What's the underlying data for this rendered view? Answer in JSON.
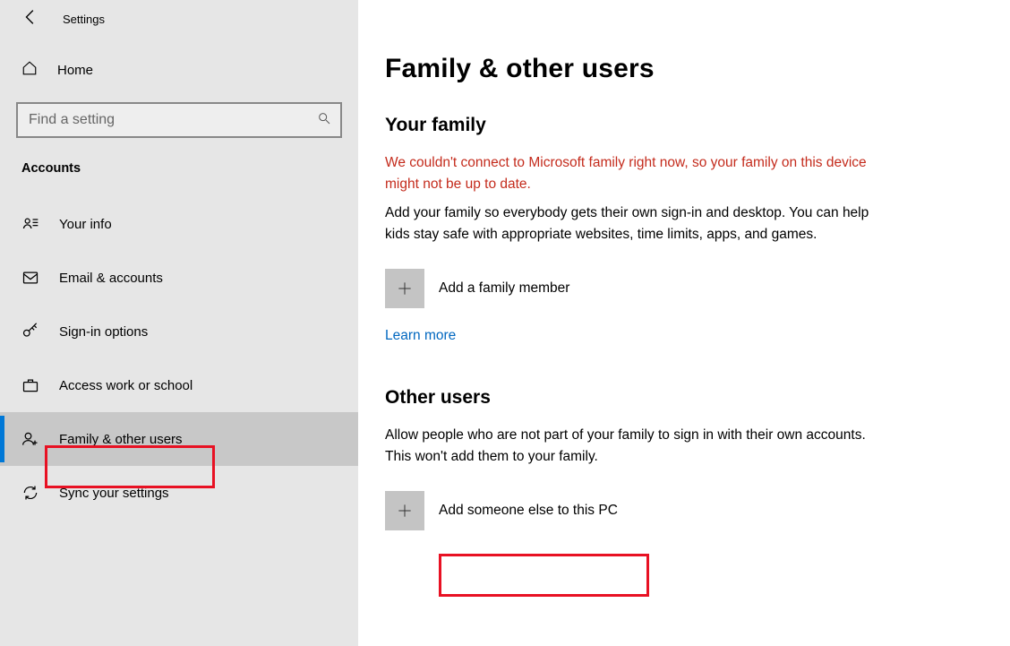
{
  "header": {
    "title": "Settings"
  },
  "home": {
    "label": "Home"
  },
  "search": {
    "placeholder": "Find a setting"
  },
  "category": "Accounts",
  "nav": [
    {
      "id": "your-info",
      "label": "Your info"
    },
    {
      "id": "email-accounts",
      "label": "Email & accounts"
    },
    {
      "id": "sign-in-options",
      "label": "Sign-in options"
    },
    {
      "id": "access-work-school",
      "label": "Access work or school"
    },
    {
      "id": "family-other-users",
      "label": "Family & other users"
    },
    {
      "id": "sync-settings",
      "label": "Sync your settings"
    }
  ],
  "main": {
    "heading": "Family & other users",
    "family": {
      "heading": "Your family",
      "error": "We couldn't connect to Microsoft family right now, so your family on this device might not be up to date.",
      "description": "Add your family so everybody gets their own sign-in and desktop. You can help kids stay safe with appropriate websites, time limits, apps, and games.",
      "add_label": "Add a family member",
      "learn_more": "Learn more"
    },
    "other": {
      "heading": "Other users",
      "description": "Allow people who are not part of your family to sign in with their own accounts. This won't add them to your family.",
      "add_label": "Add someone else to this PC"
    }
  }
}
